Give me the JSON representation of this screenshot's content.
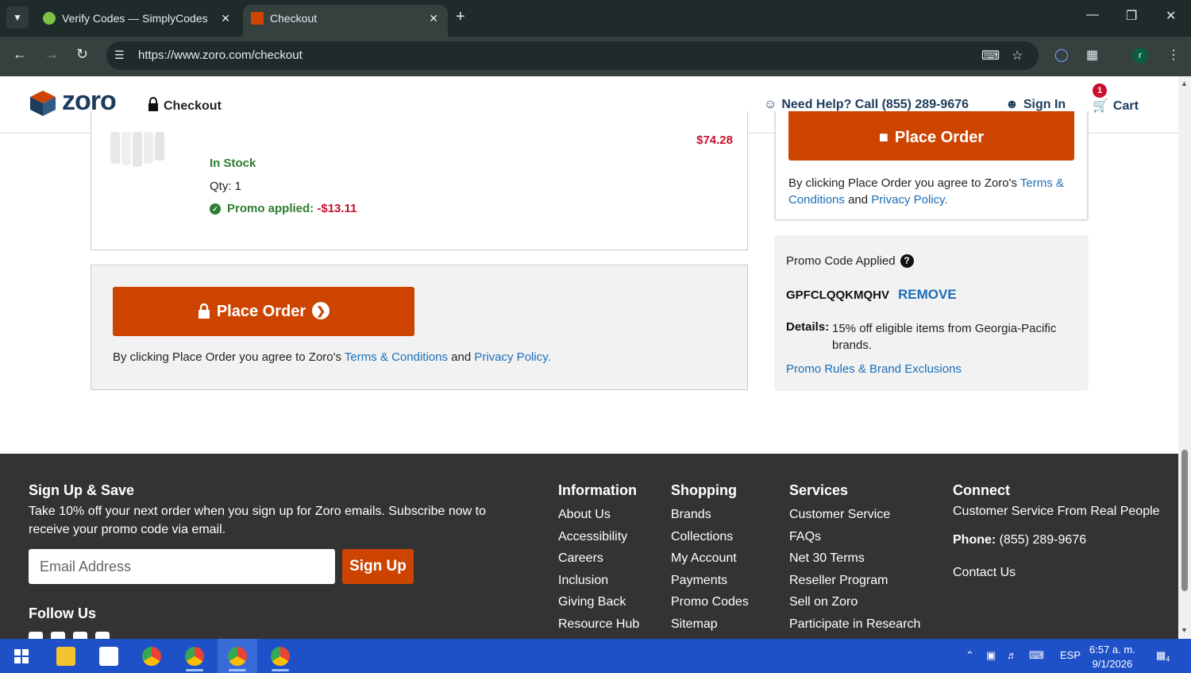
{
  "browser": {
    "tabs": [
      {
        "title": "Verify Codes — SimplyCodes",
        "active": false
      },
      {
        "title": "Checkout",
        "active": true
      }
    ],
    "url": "https://www.zoro.com/checkout"
  },
  "header": {
    "logo_text": "zoro",
    "checkout_label": "Checkout",
    "help_text": "Need Help? Call (855) 289-9676",
    "signin_label": "Sign In",
    "cart_label": "Cart",
    "cart_count": "1"
  },
  "item": {
    "price": "$74.28",
    "stock": "In Stock",
    "qty": "Qty: 1",
    "promo_label": "Promo applied:",
    "promo_amount": "-$13.11"
  },
  "place_order": {
    "button_label": "Place Order",
    "terms_prefix": "By clicking Place Order you agree to Zoro's",
    "terms_link": "Terms & Conditions",
    "and": "and",
    "privacy_link": "Privacy Policy."
  },
  "side_summary": {
    "button_label": "Place Order",
    "terms_prefix": "By clicking Place Order you agree to Zoro's",
    "terms_link": "Terms & Conditions",
    "and": "and",
    "privacy_link": "Privacy Policy."
  },
  "promo": {
    "title": "Promo Code Applied",
    "code": "GPFCLQQKMQHV",
    "remove_label": "REMOVE",
    "details_label": "Details:",
    "details_text": "15% off eligible items from Georgia-Pacific brands.",
    "rules_link": "Promo Rules & Brand Exclusions"
  },
  "footer": {
    "signup": {
      "heading": "Sign Up & Save",
      "text": "Take 10% off your next order when you sign up for Zoro emails. Subscribe now to receive your promo code via email.",
      "email_placeholder": "Email Address",
      "button": "Sign Up"
    },
    "follow_heading": "Follow Us",
    "information": {
      "heading": "Information",
      "links": [
        "About Us",
        "Accessibility",
        "Careers",
        "Inclusion",
        "Giving Back",
        "Resource Hub"
      ]
    },
    "shopping": {
      "heading": "Shopping",
      "links": [
        "Brands",
        "Collections",
        "My Account",
        "Payments",
        "Promo Codes",
        "Sitemap"
      ]
    },
    "services": {
      "heading": "Services",
      "links": [
        "Customer Service",
        "FAQs",
        "Net 30 Terms",
        "Reseller Program",
        "Sell on Zoro",
        "Participate in Research"
      ]
    },
    "connect": {
      "heading": "Connect",
      "tagline": "Customer Service From Real People",
      "phone_label": "Phone:",
      "phone": "(855) 289-9676",
      "contact_link": "Contact Us"
    }
  },
  "taskbar": {
    "language": "ESP",
    "time": "6:57 a. m.",
    "date": "9/1/2026",
    "notifications": "4"
  },
  "colors": {
    "accent_orange": "#cc4400",
    "brand_navy": "#1d3c5c",
    "link_blue": "#1b6eb8",
    "price_red": "#c8102e",
    "success_green": "#2e7d32"
  }
}
